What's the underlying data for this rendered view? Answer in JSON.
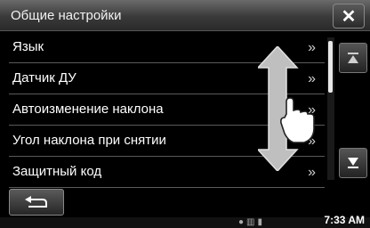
{
  "header": {
    "title": "Общие настройки",
    "close_icon": "close-icon"
  },
  "menu": {
    "items": [
      {
        "label": "Язык",
        "icon": "chevron-double-right-icon"
      },
      {
        "label": "Датчик ДУ",
        "icon": "chevron-double-right-icon"
      },
      {
        "label": "Автоизменение наклона",
        "icon": "chevron-double-right-icon"
      },
      {
        "label": "Угол наклона при снятии",
        "icon": "chevron-double-right-icon"
      },
      {
        "label": "Защитный код",
        "icon": "chevron-double-right-icon"
      }
    ]
  },
  "scroll": {
    "up_icon": "scroll-top-icon",
    "down_icon": "scroll-bottom-icon"
  },
  "footer": {
    "back_icon": "back-arrow-icon"
  },
  "status": {
    "time": "7:33 AM",
    "icons": [
      "bluetooth-icon",
      "battery-icon",
      "signal-icon"
    ]
  },
  "colors": {
    "background": "#000000",
    "titlebar": "#4a4a4a",
    "divider": "#5a5a5a",
    "text": "#ffffff"
  }
}
